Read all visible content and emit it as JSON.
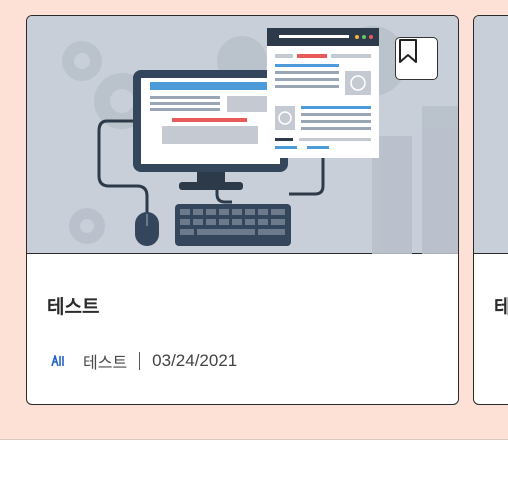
{
  "cards": [
    {
      "title": "테스트",
      "author": "테스트",
      "date": "03/24/2021",
      "author_logo_icon": "ai-logo-icon",
      "bookmark_icon": "bookmark-icon",
      "thumbnail": "computer-webpage-illustration"
    },
    {
      "title": "테"
    }
  ],
  "colors": {
    "background": "#fde1d6",
    "thumbnail_bg": "#c9cfd8",
    "accent_blue": "#3b82f6",
    "accent_red": "#ef5350"
  }
}
